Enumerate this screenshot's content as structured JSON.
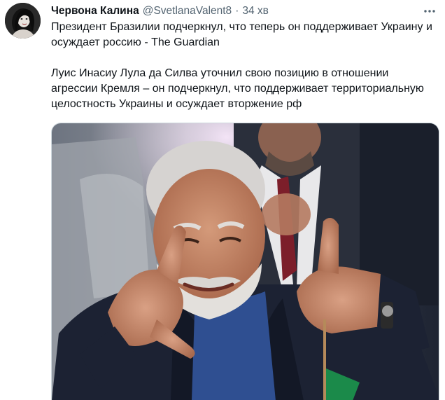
{
  "tweet": {
    "author_name": "Червона Калина",
    "author_handle": "@SvetlanaValent8",
    "separator": "·",
    "time": "34 хв",
    "paragraph_1": "Президент Бразилии подчеркнул, что теперь он поддерживает Украину и осуждает россию - The Guardian",
    "paragraph_2": "Луис Инасиу Лула да Силва уточнил свою позицию в отношении агрессии Кремля – он подчеркнул, что поддерживает территориальную целостность Украины и осуждает вторжение рф"
  },
  "icons": {
    "more": "more-icon"
  },
  "colors": {
    "text_primary": "#0f1419",
    "text_secondary": "#536471",
    "border": "#cfd9de"
  }
}
